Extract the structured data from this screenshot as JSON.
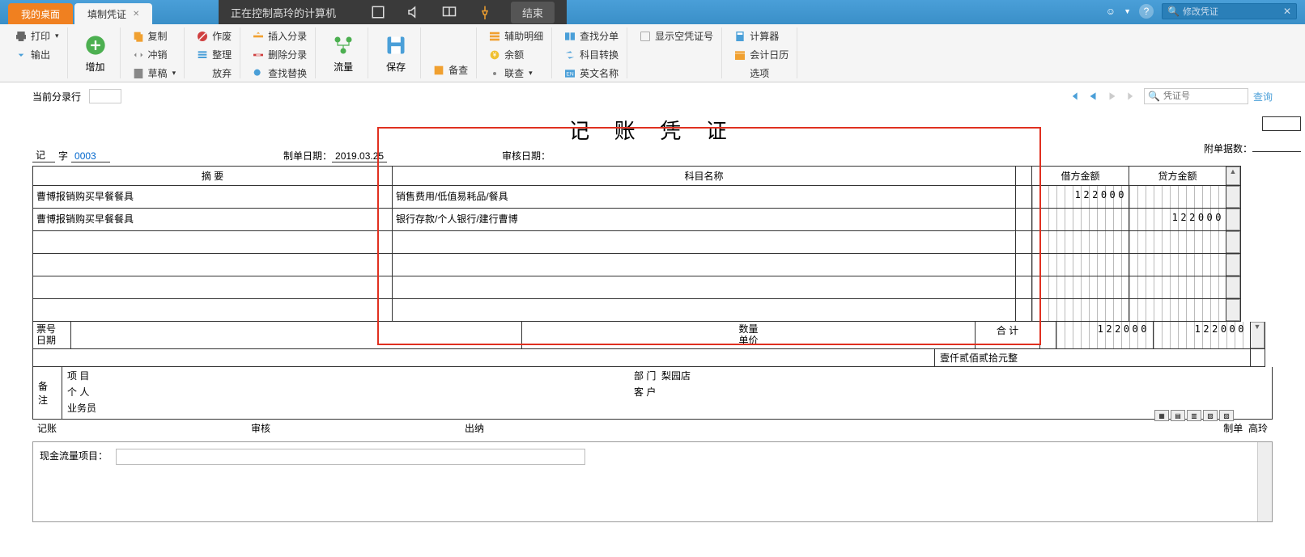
{
  "remote": {
    "label": "正在控制高玲的计算机",
    "end": "结束"
  },
  "tabs": {
    "desktop": "我的桌面",
    "voucher": "填制凭证"
  },
  "topSearch": {
    "placeholder": "",
    "value": "修改凭证"
  },
  "ribbon": {
    "print": "打印",
    "export": "输出",
    "add": "增加",
    "copy": "复制",
    "offset": "冲销",
    "draft": "草稿",
    "void": "作废",
    "tidy": "整理",
    "abandon": "放弃",
    "insert": "插入分录",
    "delrow": "删除分录",
    "findrep": "查找替换",
    "flow": "流量",
    "save": "保存",
    "backup": "备查",
    "aux": "辅助明细",
    "balance": "余额",
    "link": "联查",
    "findsplit": "查找分单",
    "acct": "科目转换",
    "eng": "英文名称",
    "empty": "显示空凭证号",
    "calc": "计算器",
    "calendar": "会计日历",
    "option": "选项"
  },
  "subbar": {
    "currentRow": "当前分录行",
    "voucherNo": "凭证号",
    "query": "查询"
  },
  "voucher": {
    "title": "记 账 凭 证",
    "zi": "记",
    "ziSuffix": "字",
    "number": "0003",
    "makeDateLabel": "制单日期：",
    "makeDate": "2019.03.25",
    "auditDateLabel": "审核日期：",
    "attachLabel": "附单据数：",
    "headers": {
      "summary": "摘 要",
      "account": "科目名称",
      "debit": "借方金额",
      "credit": "贷方金额"
    },
    "rows": [
      {
        "summary": "曹博报销购买早餐餐具",
        "account": "销售费用/低值易耗品/餐具",
        "debit": "122000",
        "credit": ""
      },
      {
        "summary": "曹博报销购买早餐餐具",
        "account": "银行存款/个人银行/建行曹博",
        "debit": "",
        "credit": "122000"
      },
      {
        "summary": "",
        "account": "",
        "debit": "",
        "credit": ""
      },
      {
        "summary": "",
        "account": "",
        "debit": "",
        "credit": ""
      },
      {
        "summary": "",
        "account": "",
        "debit": "",
        "credit": ""
      },
      {
        "summary": "",
        "account": "",
        "debit": "",
        "credit": ""
      }
    ],
    "totals": {
      "ticket": "票号",
      "date": "日期",
      "qty": "数量",
      "price": "单价",
      "totalLabel": "合 计",
      "chinese": "壹仟贰佰贰拾元整",
      "debit": "122000",
      "credit": "122000"
    },
    "remark": {
      "label": "备注",
      "l1a": "项 目",
      "l1b": "部 门",
      "l1bv": "梨园店",
      "l2a": "个 人",
      "l2b": "客 户",
      "l3a": "业务员"
    },
    "sign": {
      "record": "记账",
      "audit": "审核",
      "cashier": "出纳",
      "make": "制单",
      "maker": "高玲"
    },
    "cashflow": "现金流量项目："
  }
}
